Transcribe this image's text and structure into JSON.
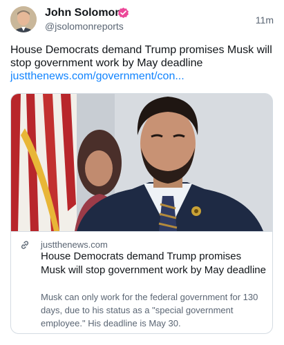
{
  "author": {
    "name": "John Solomon",
    "handle": "@jsolomonreports",
    "time": "11m"
  },
  "post": {
    "text": "House Democrats demand Trump promises Musk will stop government work by May deadline",
    "link": "justthenews.com/government/con..."
  },
  "embed": {
    "domain": "justthenews.com",
    "title": "House Democrats demand Trump promises Musk will stop government work by May deadline",
    "description": "Musk can only work for the federal government for 130 days, due to his status as a \"special government employee.\" His deadline is May 30."
  },
  "colors": {
    "link": "#1083fe",
    "verified": "#ec4899",
    "muted": "#5a6573",
    "border": "#d4dbe2"
  },
  "icons": {
    "verified": "verified-badge-icon",
    "link": "link-chain-icon"
  }
}
